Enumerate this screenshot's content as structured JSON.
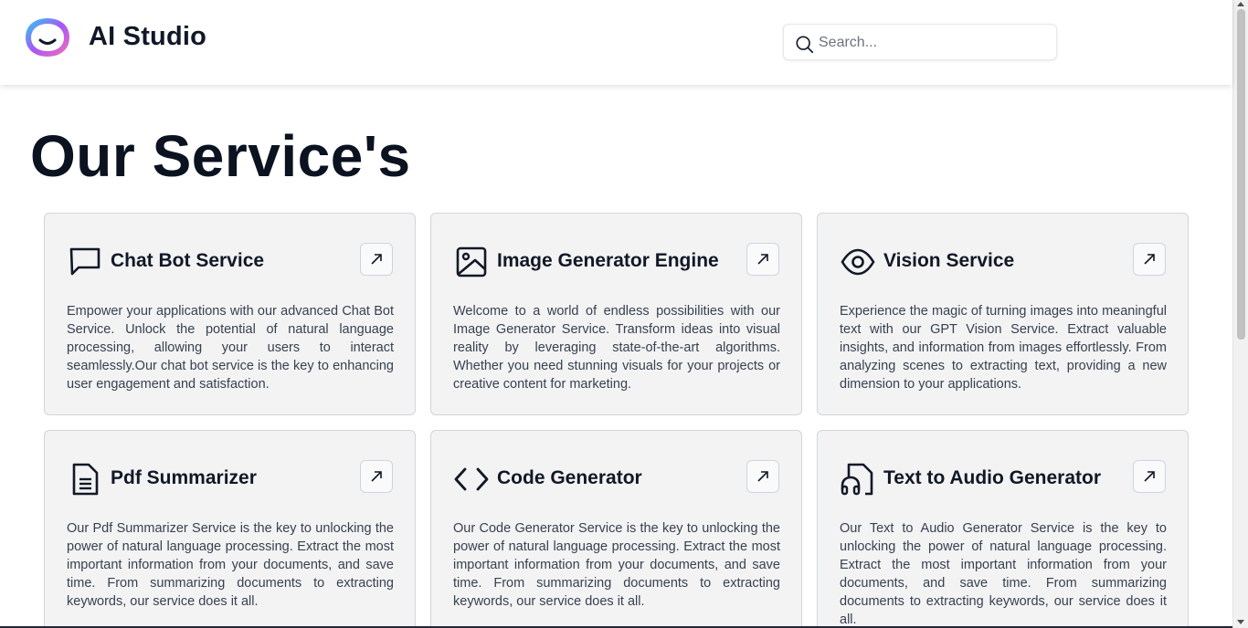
{
  "header": {
    "brand": "AI Studio",
    "search_placeholder": "Search..."
  },
  "page": {
    "title": "Our Service's"
  },
  "services": [
    {
      "title": "Chat Bot Service",
      "icon": "chat-bubble-icon",
      "description": "Empower your applications with our advanced Chat Bot Service. Unlock the potential of natural language processing, allowing your users to interact seamlessly.Our chat bot service is the key to enhancing user engagement and satisfaction."
    },
    {
      "title": "Image Generator Engine",
      "icon": "image-icon",
      "description": "Welcome to a world of endless possibilities with our Image Generator Service. Transform ideas into visual reality by leveraging state-of-the-art algorithms. Whether you need stunning visuals for your projects or creative content for marketing."
    },
    {
      "title": "Vision Service",
      "icon": "eye-icon",
      "description": "Experience the magic of turning images into meaningful text with our GPT Vision Service. Extract valuable insights, and information from images effortlessly. From analyzing scenes to extracting text, providing a new dimension to your applications."
    },
    {
      "title": "Pdf Summarizer",
      "icon": "document-icon",
      "description": "Our Pdf Summarizer Service is the key to unlocking the power of natural language processing. Extract the most important information from your documents, and save time. From summarizing documents to extracting keywords, our service does it all."
    },
    {
      "title": "Code Generator",
      "icon": "code-icon",
      "description": "Our Code Generator Service is the key to unlocking the power of natural language processing. Extract the most important information from your documents, and save time. From summarizing documents to extracting keywords, our service does it all."
    },
    {
      "title": "Text to Audio Generator",
      "icon": "audio-file-icon",
      "description": "Our Text to Audio Generator Service is the key to unlocking the power of natural language processing. Extract the most important information from your documents, and save time. From summarizing documents to extracting keywords, our service does it all."
    }
  ],
  "colors": {
    "card_bg": "#f3f3f3",
    "title_text": "#0b1220",
    "body_text": "#374151",
    "logo_gradient": [
      "#f472b6",
      "#a855f7",
      "#22d3ee"
    ]
  }
}
